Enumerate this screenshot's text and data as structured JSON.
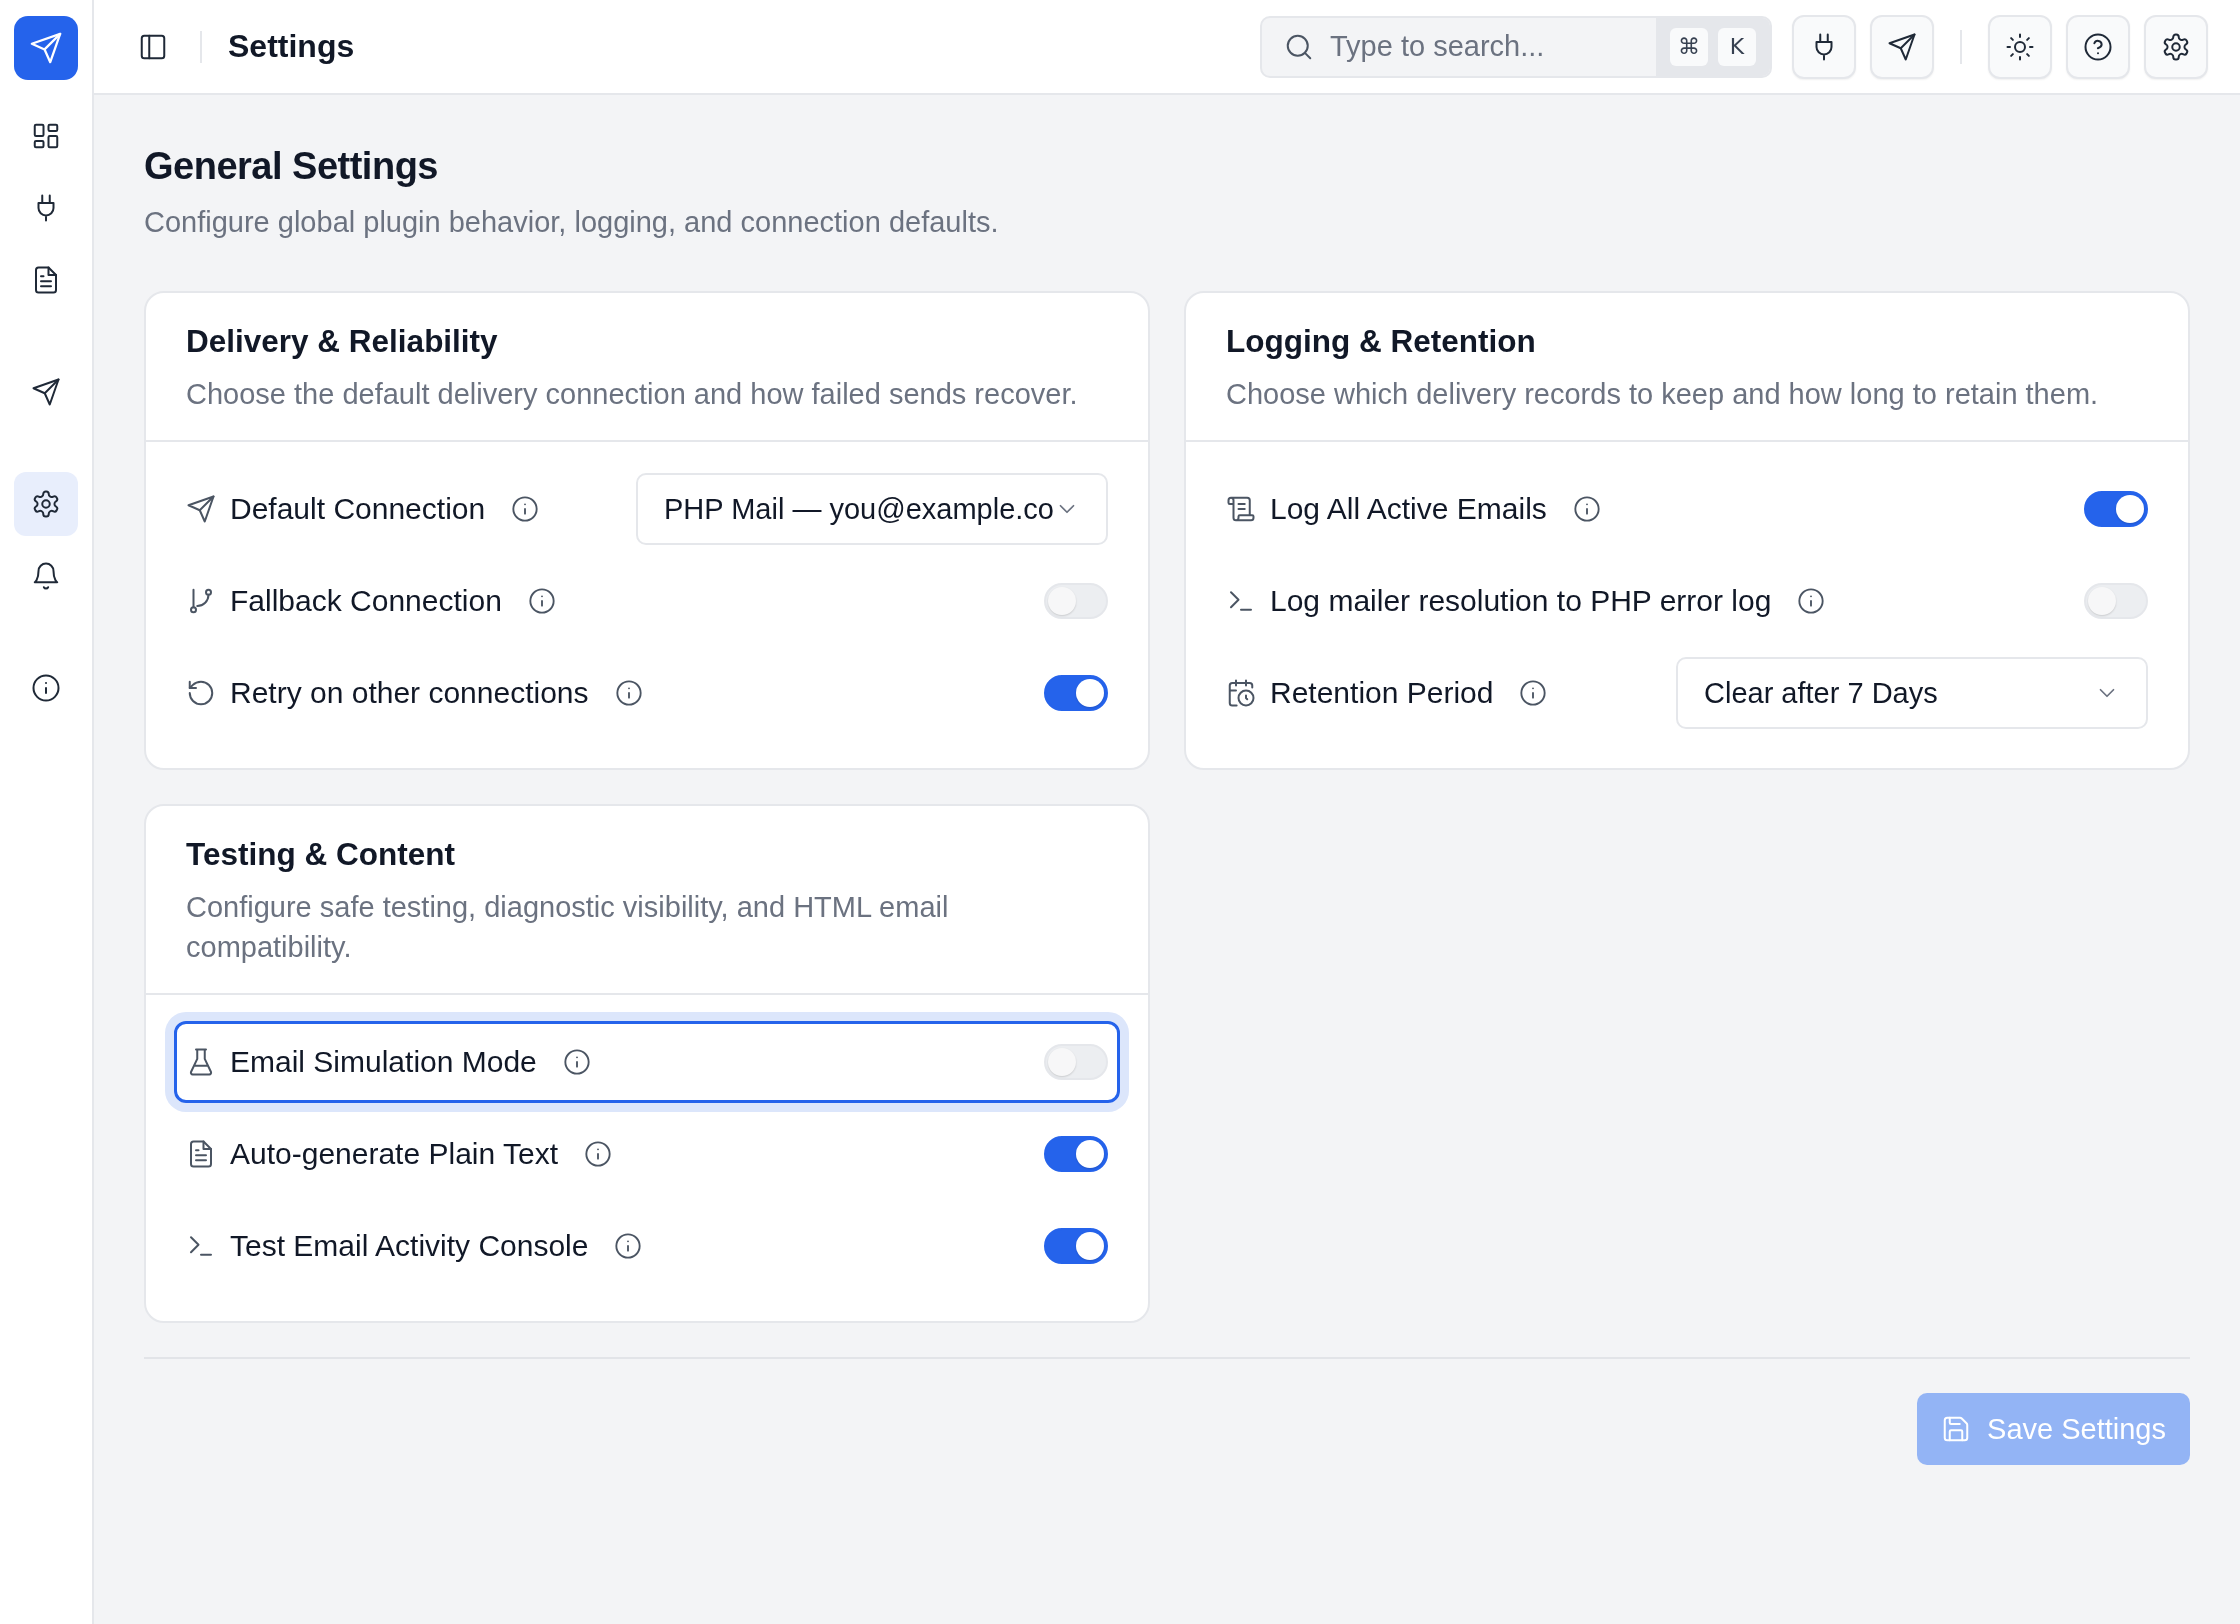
{
  "header": {
    "title": "Settings"
  },
  "search": {
    "placeholder": "Type to search...",
    "shortcut": [
      "⌘",
      "K"
    ]
  },
  "sidebar": {
    "items": [
      {
        "selected": false
      },
      {
        "selected": false
      },
      {
        "selected": false
      },
      {
        "selected": false
      },
      {
        "selected": true
      },
      {
        "selected": false
      },
      {
        "selected": false
      }
    ]
  },
  "page": {
    "title": "General Settings",
    "description": "Configure global plugin behavior, logging, and connection defaults."
  },
  "cards": [
    {
      "title": "Delivery & Reliability",
      "description": "Choose the default delivery connection and how failed sends recover.",
      "rows": [
        {
          "kind": "select",
          "label": "Default Connection",
          "value": "PHP Mail — you@example.co",
          "focused": false
        },
        {
          "kind": "toggle",
          "label": "Fallback Connection",
          "on": false,
          "focused": false
        },
        {
          "kind": "toggle",
          "label": "Retry on other connections",
          "on": true,
          "focused": false
        }
      ]
    },
    {
      "title": "Logging & Retention",
      "description": "Choose which delivery records to keep and how long to retain them.",
      "rows": [
        {
          "kind": "toggle",
          "label": "Log All Active Emails",
          "on": true,
          "focused": false
        },
        {
          "kind": "toggle",
          "label": "Log mailer resolution to PHP error log",
          "on": false,
          "focused": false
        },
        {
          "kind": "select",
          "label": "Retention Period",
          "value": "Clear after 7 Days",
          "focused": false
        }
      ]
    },
    {
      "title": "Testing & Content",
      "description": "Configure safe testing, diagnostic visibility, and HTML email compatibility.",
      "rows": [
        {
          "kind": "toggle",
          "label": "Email Simulation Mode",
          "on": false,
          "focused": true
        },
        {
          "kind": "toggle",
          "label": "Auto-generate Plain Text",
          "on": true,
          "focused": false
        },
        {
          "kind": "toggle",
          "label": "Test Email Activity Console",
          "on": true,
          "focused": false
        }
      ]
    }
  ],
  "save": {
    "label": "Save Settings",
    "disabled": true
  }
}
